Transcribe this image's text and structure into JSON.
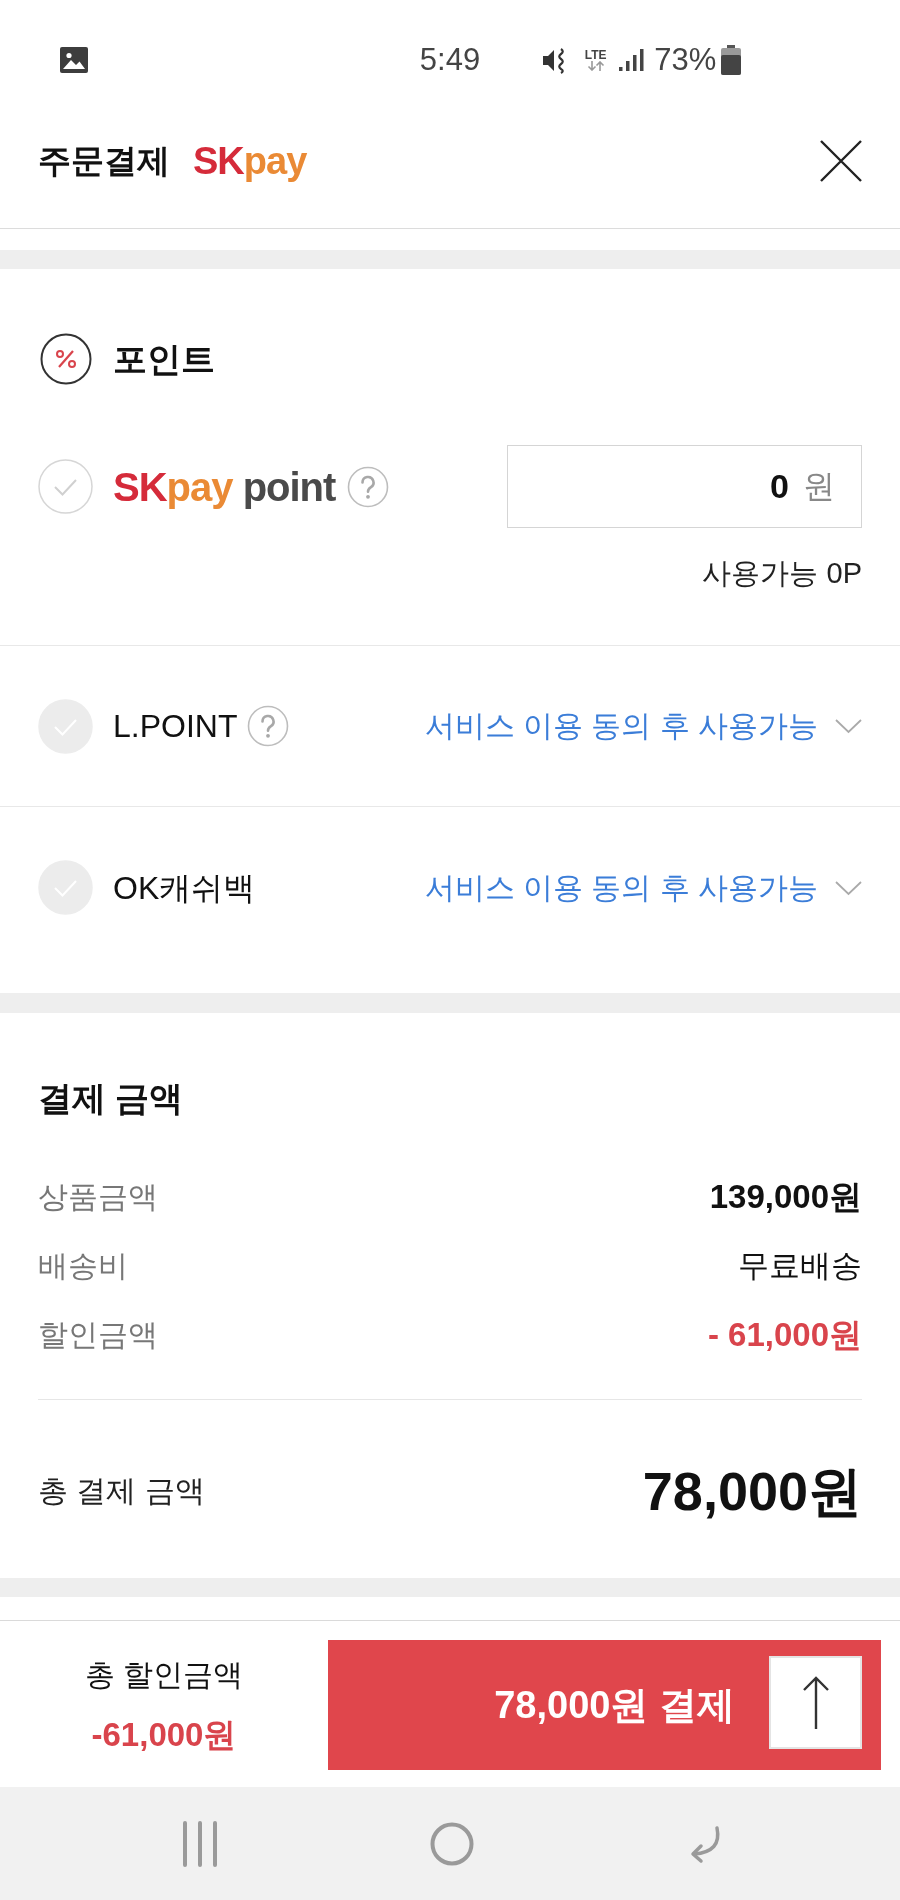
{
  "status_bar": {
    "time": "5:49",
    "network": "LTE",
    "battery": "73%"
  },
  "header": {
    "title": "주문결제",
    "logo": [
      {
        "kind": "mark",
        "text": "SK"
      },
      {
        "kind": "word",
        "text": "pay"
      }
    ]
  },
  "points": {
    "title": "포인트",
    "sk_pay_point": {
      "logo": [
        {
          "kind": "mark",
          "text": "SK"
        },
        {
          "kind": "word",
          "text": "pay"
        },
        {
          "kind": "suffix",
          "text": "point"
        }
      ],
      "checked": false,
      "disabled": false,
      "has_help": true,
      "value": "0",
      "unit": "원",
      "available": "사용가능 0P"
    },
    "others": [
      {
        "label": "L.POINT",
        "checked": false,
        "disabled": true,
        "has_help": true,
        "status": "서비스 이용 동의 후 사용가능",
        "expanded": false
      },
      {
        "label": "OK캐쉬백",
        "checked": false,
        "disabled": true,
        "has_help": false,
        "status": "서비스 이용 동의 후 사용가능",
        "expanded": false
      }
    ]
  },
  "payment": {
    "title": "결제 금액",
    "lines": [
      {
        "label": "상품금액",
        "value": "139,000원",
        "kind": "price"
      },
      {
        "label": "배송비",
        "value": "무료배송",
        "kind": "text"
      },
      {
        "label": "할인금액",
        "value": "- 61,000원",
        "kind": "discount"
      }
    ],
    "total": {
      "label": "총 결제 금액",
      "value": "78,000원"
    }
  },
  "bottom_bar": {
    "discount_label": "총 할인금액",
    "discount_value": "-61,000원",
    "pay_button": "78,000원 결제"
  }
}
